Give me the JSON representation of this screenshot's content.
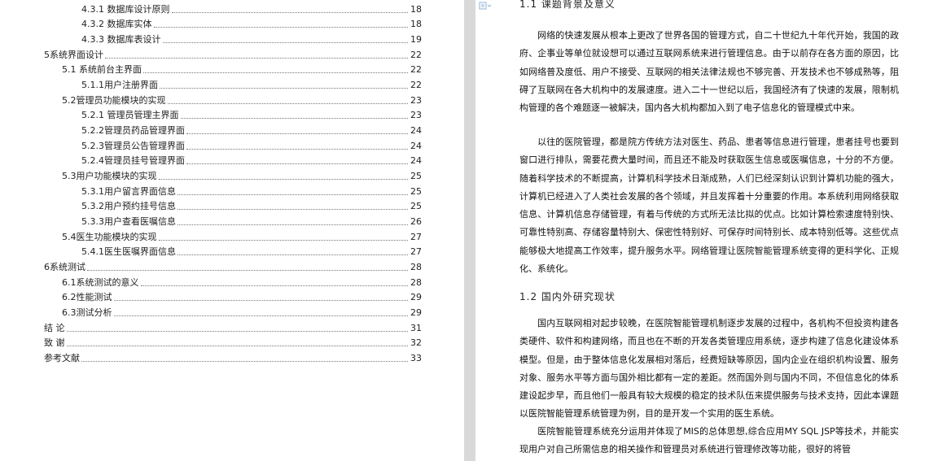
{
  "toc": [
    {
      "label": "4.3.1 数据库设计原则",
      "page": "18"
    },
    {
      "label": "4.3.2 数据库实体",
      "page": "18"
    },
    {
      "label": "4.3.3 数据库表设计",
      "page": "19"
    },
    {
      "label": "5系统界面设计",
      "page": "22"
    },
    {
      "label": "5.1 系统前台主界面",
      "page": "22"
    },
    {
      "label": "5.1.1用户注册界面",
      "page": "22"
    },
    {
      "label": "5.2管理员功能模块的实现",
      "page": "23"
    },
    {
      "label": "5.2.1 管理员管理主界面",
      "page": "23"
    },
    {
      "label": "5.2.2管理员药品管理界面",
      "page": "24"
    },
    {
      "label": "5.2.3管理员公告管理界面",
      "page": "24"
    },
    {
      "label": "5.2.4管理员挂号管理界面",
      "page": "24"
    },
    {
      "label": "5.3用户功能模块的实现",
      "page": "25"
    },
    {
      "label": "5.3.1用户留言界面信息",
      "page": "25"
    },
    {
      "label": "5.3.2用户预约挂号信息",
      "page": "25"
    },
    {
      "label": "5.3.3用户查看医嘱信息",
      "page": "26"
    },
    {
      "label": "5.4医生功能模块的实现",
      "page": "27"
    },
    {
      "label": "5.4.1医生医嘱界面信息",
      "page": "27"
    },
    {
      "label": "6系统测试",
      "page": "28"
    },
    {
      "label": "6.1系统测试的意义",
      "page": "28"
    },
    {
      "label": "6.2性能测试",
      "page": "29"
    },
    {
      "label": "6.3测试分析",
      "page": "29"
    },
    {
      "label": "结    论",
      "page": "31"
    },
    {
      "label": "致    谢",
      "page": "32"
    },
    {
      "label": "参考文献",
      "page": "33"
    }
  ],
  "doc": {
    "heading1": "1.1 课题背景及意义",
    "para1": "网络的快速发展从根本上更改了世界各国的管理方式，自二十世纪九十年代开始，我国的政府、企事业等单位就设想可以通过互联网系统来进行管理信息。由于以前存在各方面的原因，比如网络普及度低、用户不接受、互联网的相关法律法规也不够完善、开发技术也不够成熟等，阻碍了互联网在各大机构中的发展速度。进入二十一世纪以后，我国经济有了快速的发展，限制机构管理的各个难题逐一被解决，国内各大机构都加入到了电子信息化的管理模式中来。",
    "para2": "以往的医院管理，都是院方传统方法对医生、药品、患者等信息进行管理，患者挂号也要到窗口进行排队，需要花费大量时间，而且还不能及时获取医生信息或医嘱信息，十分的不方便。随着科学技术的不断提高，计算机科学技术日渐成熟，人们已经深刻认识到计算机功能的强大，计算机已经进入了人类社会发展的各个领域，并且发挥着十分重要的作用。本系统利用网络获取信息、计算机信息存储管理，有着与传统的方式所无法比拟的优点。比如计算检索速度特别快、可靠性特别高、存储容量特别大、保密性特别好、可保存时间特别长、成本特别低等。这些优点能够极大地提高工作效率，提升服务水平。网络管理让医院智能管理系统变得的更科学化、正规化、系统化。",
    "heading2": "1.2 国内外研究现状",
    "para3": "国内互联网相对起步较晚，在医院智能管理机制逐步发展的过程中，各机构不但投资构建各类硬件、软件和构建网络，而且也在不断的开发各类管理应用系统，逐步构建了信息化建设体系模型。但是，由于整体信息化发展相对落后，经费短缺等原因，国内企业在组织机构设置、服务对象、服务水平等方面与国外相比都有一定的差距。然而国外则与国内不同，不但信息化的体系建设起步早，而且他们一般具有较大规模的稳定的技术队伍来提供服务与技术支持，因此本课题以医院智能管理系统管理为例，目的是开发一个实用的医生系统。",
    "para4": "医院智能管理系统充分运用并体现了MIS的总体思想,综合应用MY SQL JSP等技术，并能实现用户对自己所需信息的相关操作和管理员对系统进行管理修改等功能，很好的将管"
  }
}
